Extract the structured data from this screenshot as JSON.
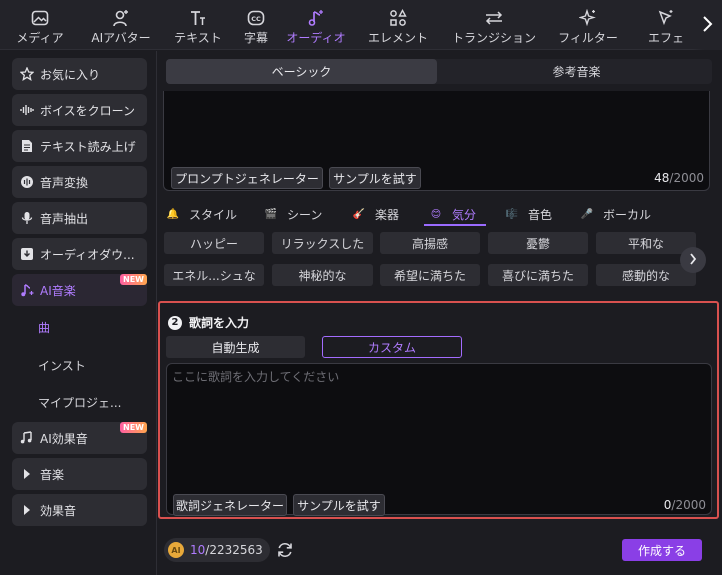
{
  "toolbar": {
    "items": [
      {
        "label": "メディア",
        "icon": "media-icon"
      },
      {
        "label": "AIアバター",
        "icon": "ai-avatar-icon"
      },
      {
        "label": "テキスト",
        "icon": "text-icon"
      },
      {
        "label": "字幕",
        "icon": "caption-icon"
      },
      {
        "label": "オーディオ",
        "icon": "audio-icon",
        "active": true
      },
      {
        "label": "エレメント",
        "icon": "element-icon"
      },
      {
        "label": "トランジション",
        "icon": "transition-icon"
      },
      {
        "label": "フィルター",
        "icon": "filter-icon"
      },
      {
        "label": "エフェ",
        "icon": "effect-icon"
      }
    ],
    "more_icon": "chevron-right-icon"
  },
  "sidebar": {
    "items": [
      {
        "label": "お気に入り",
        "icon": "star-icon"
      },
      {
        "label": "ボイスをクローン",
        "icon": "waveform-icon"
      },
      {
        "label": "テキスト読み上げ",
        "icon": "text-to-speech-icon"
      },
      {
        "label": "音声変換",
        "icon": "voice-change-icon"
      },
      {
        "label": "音声抽出",
        "icon": "microphone-icon"
      },
      {
        "label": "オーディオダウ...",
        "icon": "download-icon"
      },
      {
        "label": "AI音楽",
        "icon": "ai-music-icon",
        "badge": "NEW",
        "active": true
      },
      {
        "label": "AI効果音",
        "icon": "ai-sfx-icon",
        "badge": "NEW"
      },
      {
        "label": "音楽",
        "icon": "caret-right-icon"
      },
      {
        "label": "効果音",
        "icon": "caret-right-icon"
      }
    ],
    "subitems": [
      {
        "label": "曲",
        "active": true
      },
      {
        "label": "インスト"
      },
      {
        "label": "マイプロジェ..."
      }
    ]
  },
  "main": {
    "tabs": [
      {
        "label": "ベーシック",
        "active": true
      },
      {
        "label": "参考音楽"
      }
    ],
    "prompt": {
      "generator_label": "プロンプトジェネレーター",
      "sample_label": "サンプルを試す",
      "count": "48",
      "max": "/2000"
    },
    "categories": [
      {
        "label": "スタイル",
        "icon": "🔔"
      },
      {
        "label": "シーン",
        "icon": "🎬"
      },
      {
        "label": "楽器",
        "icon": "🎸"
      },
      {
        "label": "気分",
        "icon": "😊",
        "active": true
      },
      {
        "label": "音色",
        "icon": "🎼"
      },
      {
        "label": "ボーカル",
        "icon": "🎤"
      }
    ],
    "mood_tags": [
      [
        "ハッピー",
        "リラックスした",
        "高揚感",
        "憂鬱",
        "平和な"
      ],
      [
        "エネル...シュな",
        "神秘的な",
        "希望に満ちた",
        "喜びに満ちた",
        "感動的な"
      ]
    ],
    "lyrics": {
      "step_number": "2",
      "step_title": "歌詞を入力",
      "mode_auto": "自動生成",
      "mode_custom": "カスタム",
      "placeholder": "ここに歌詞を入力してください",
      "value": "",
      "generator_label": "歌詞ジェネレーター",
      "sample_label": "サンプルを試す",
      "count": "0",
      "max": "/2000"
    },
    "footer": {
      "credits_used": "10",
      "credits_total": "/2232563",
      "create_label": "作成する"
    }
  },
  "colors": {
    "accent": "#b07cff",
    "create_button": "#8a3fe6",
    "highlight_border": "#d8514f",
    "badge_new": "#ff5fa2"
  }
}
